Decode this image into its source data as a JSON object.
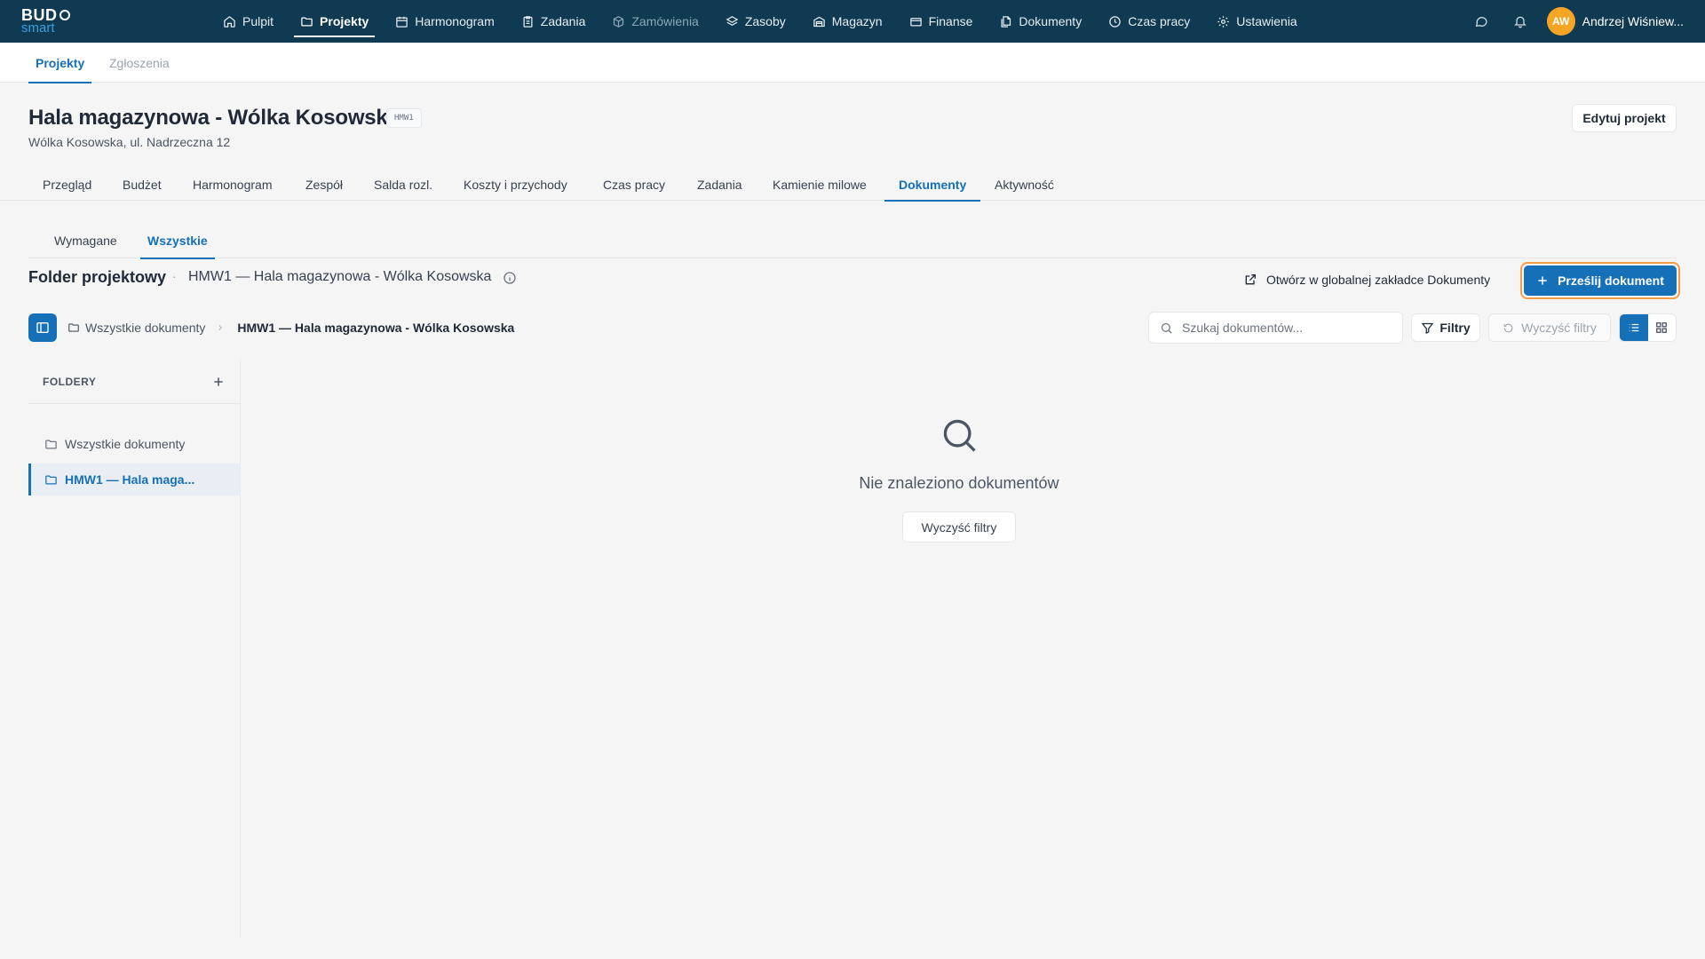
{
  "app": {
    "logo_top": "BUD",
    "logo_bottom": "smart"
  },
  "topnav": {
    "items": [
      {
        "label": "Pulpit",
        "icon": "home-icon"
      },
      {
        "label": "Projekty",
        "icon": "folder-icon"
      },
      {
        "label": "Harmonogram",
        "icon": "calendar-icon"
      },
      {
        "label": "Zadania",
        "icon": "clipboard-icon"
      },
      {
        "label": "Zamówienia",
        "icon": "package-icon"
      },
      {
        "label": "Zasoby",
        "icon": "layers-icon"
      },
      {
        "label": "Magazyn",
        "icon": "warehouse-icon"
      },
      {
        "label": "Finanse",
        "icon": "credit-card-icon"
      },
      {
        "label": "Dokumenty",
        "icon": "files-icon"
      },
      {
        "label": "Czas pracy",
        "icon": "clock-icon"
      },
      {
        "label": "Ustawienia",
        "icon": "gear-icon"
      }
    ],
    "active": "Projekty",
    "disabled": "Zamówienia"
  },
  "user": {
    "initials": "AW",
    "name": "Andrzej Wiśniew..."
  },
  "subtabs": [
    "Projekty",
    "Zgłoszenia"
  ],
  "project": {
    "title": "Hala magazynowa - Wólka Kosowska",
    "code": "HMW1",
    "address": "Wólka Kosowska, ul. Nadrzeczna 12",
    "edit_label": "Edytuj projekt"
  },
  "project_tabs": [
    "Przegląd",
    "Budżet",
    "Harmonogram",
    "Zespół",
    "Salda rozl.",
    "Koszty i przychody",
    "Czas pracy",
    "Zadania",
    "Kamienie milowe",
    "Dokumenty",
    "Aktywność"
  ],
  "project_tab_active": "Dokumenty",
  "doc_tabs": [
    "Wymagane",
    "Wszystkie"
  ],
  "doc_tab_active": "Wszystkie",
  "folder_header": {
    "title": "Folder projektowy",
    "separator": "·",
    "subtitle": "HMW1 — Hala magazynowa - Wólka Kosowska",
    "open_global": "Otwórz w globalnej zakładce Dokumenty",
    "upload": "Prześlij dokument"
  },
  "breadcrumb": {
    "root": "Wszystkie dokumenty",
    "current": "HMW1 — Hala magazynowa - Wólka Kosowska"
  },
  "toolbar": {
    "search_placeholder": "Szukaj dokumentów...",
    "filters": "Filtry",
    "clear_filters": "Wyczyść filtry",
    "view_mode": "list"
  },
  "folders": {
    "header": "FOLDERY",
    "items": [
      "Wszystkie dokumenty",
      "HMW1 — Hala maga..."
    ],
    "active_index": 1
  },
  "empty_state": {
    "message": "Nie znaleziono dokumentów",
    "button": "Wyczyść filtry"
  },
  "colors": {
    "topbar": "#0f3a52",
    "accent": "#1570b8",
    "highlight_outline": "#f39c4a",
    "avatar": "#f5a524"
  }
}
